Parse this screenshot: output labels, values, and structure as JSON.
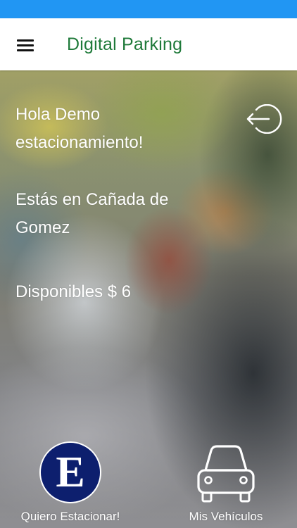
{
  "header": {
    "title": "Digital Parking",
    "menu_icon": "hamburger-menu-icon",
    "status_bar_color": "#2196f3",
    "title_color": "#1f7a3a"
  },
  "main": {
    "greeting": "Hola Demo estacionamiento!",
    "location": "Estás en Cañada de Gomez",
    "balance": "Disponibles $ 6",
    "logout_icon": "logout-icon"
  },
  "bottom_actions": [
    {
      "label": "Quiero Estacionar!",
      "icon": "estacionamiento-logo",
      "logo_letter": "E",
      "logo_color": "#0d1f6e"
    },
    {
      "label": "Mis Vehículos",
      "icon": "car-icon"
    }
  ]
}
